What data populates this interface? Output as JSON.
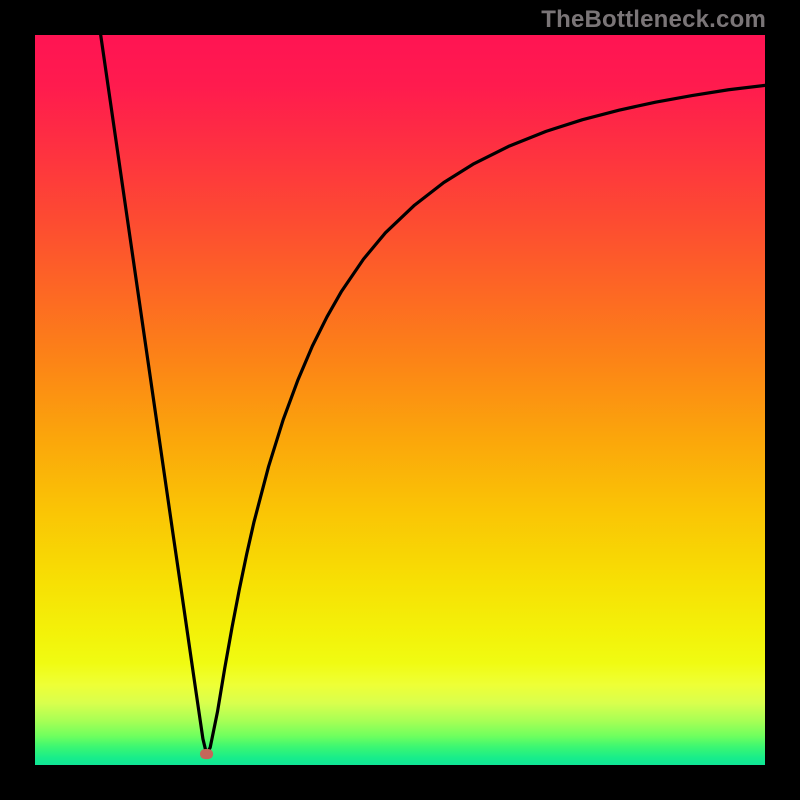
{
  "watermark": "TheBottleneck.com",
  "chart_data": {
    "type": "line",
    "title": "",
    "xlabel": "",
    "ylabel": "",
    "xlim": [
      0,
      100
    ],
    "ylim": [
      0,
      100
    ],
    "grid": false,
    "legend": false,
    "marker": {
      "x": 23.5,
      "y": 1.5,
      "color": "#c6665a",
      "r": 6
    },
    "gradient_stops": [
      {
        "offset": 0.0,
        "color": "#ff1453"
      },
      {
        "offset": 0.07,
        "color": "#ff1b4e"
      },
      {
        "offset": 0.16,
        "color": "#fe3240"
      },
      {
        "offset": 0.25,
        "color": "#fd4a32"
      },
      {
        "offset": 0.35,
        "color": "#fd6724"
      },
      {
        "offset": 0.45,
        "color": "#fc8516"
      },
      {
        "offset": 0.55,
        "color": "#fba50b"
      },
      {
        "offset": 0.65,
        "color": "#fac405"
      },
      {
        "offset": 0.75,
        "color": "#f7e004"
      },
      {
        "offset": 0.82,
        "color": "#f3f209"
      },
      {
        "offset": 0.86,
        "color": "#f0fb12"
      },
      {
        "offset": 0.89,
        "color": "#eeff36"
      },
      {
        "offset": 0.915,
        "color": "#d9ff4d"
      },
      {
        "offset": 0.94,
        "color": "#a6ff55"
      },
      {
        "offset": 0.96,
        "color": "#70ff5e"
      },
      {
        "offset": 0.975,
        "color": "#3cf772"
      },
      {
        "offset": 0.99,
        "color": "#18ed8a"
      },
      {
        "offset": 1.0,
        "color": "#0fe596"
      }
    ],
    "series": [
      {
        "name": "curve",
        "color": "#000000",
        "x": [
          9,
          10,
          11,
          12,
          13,
          14,
          15,
          16,
          17,
          18,
          19,
          20,
          21,
          22,
          23,
          23.5,
          24,
          25,
          26,
          27,
          28,
          29,
          30,
          32,
          34,
          36,
          38,
          40,
          42,
          45,
          48,
          52,
          56,
          60,
          65,
          70,
          75,
          80,
          85,
          90,
          95,
          100
        ],
        "y": [
          100,
          93.1,
          86.2,
          79.3,
          72.4,
          65.5,
          58.6,
          51.7,
          44.8,
          37.9,
          31.0,
          24.2,
          17.3,
          10.4,
          3.6,
          1.5,
          2.4,
          7.3,
          13.3,
          18.9,
          24.1,
          28.9,
          33.3,
          40.9,
          47.3,
          52.7,
          57.4,
          61.4,
          64.9,
          69.3,
          72.9,
          76.7,
          79.8,
          82.3,
          84.8,
          86.8,
          88.4,
          89.7,
          90.8,
          91.7,
          92.5,
          93.1
        ]
      }
    ]
  }
}
